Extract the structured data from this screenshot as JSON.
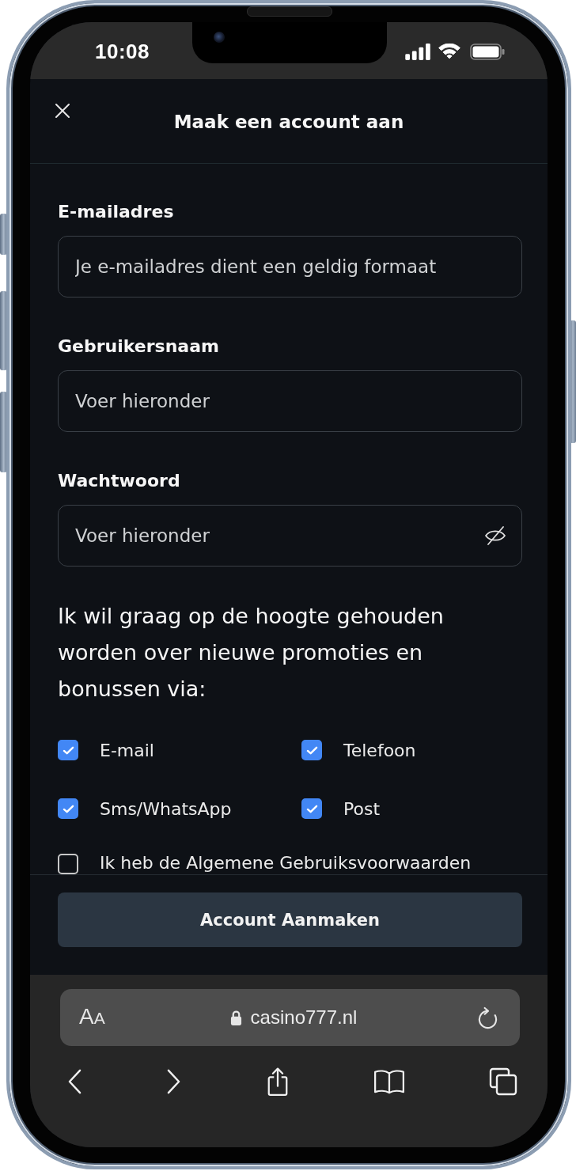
{
  "status_bar": {
    "time": "10:08"
  },
  "header": {
    "title": "Maak een account aan"
  },
  "form": {
    "fields": [
      {
        "label": "E-mailadres",
        "placeholder": "Je e-mailadres dient een geldig formaat",
        "kind": "email"
      },
      {
        "label": "Gebruikersnaam",
        "placeholder": "Voer hieronder",
        "kind": "text"
      },
      {
        "label": "Wachtwoord",
        "placeholder": "Voer hieronder",
        "kind": "password"
      }
    ],
    "consent_text": "Ik wil graag op de hoogte gehouden worden over nieuwe promoties en bonussen via:",
    "channels": [
      {
        "label": "E-mail",
        "checked": true
      },
      {
        "label": "Telefoon",
        "checked": true
      },
      {
        "label": "Sms/WhatsApp",
        "checked": true
      },
      {
        "label": "Post",
        "checked": true
      }
    ],
    "terms": {
      "label": "Ik heb de Algemene Gebruiksvoorwaarden",
      "checked": false
    }
  },
  "footer": {
    "submit": "Account Aanmaken"
  },
  "browser": {
    "text_size": "AA",
    "url": "casino777.nl"
  }
}
